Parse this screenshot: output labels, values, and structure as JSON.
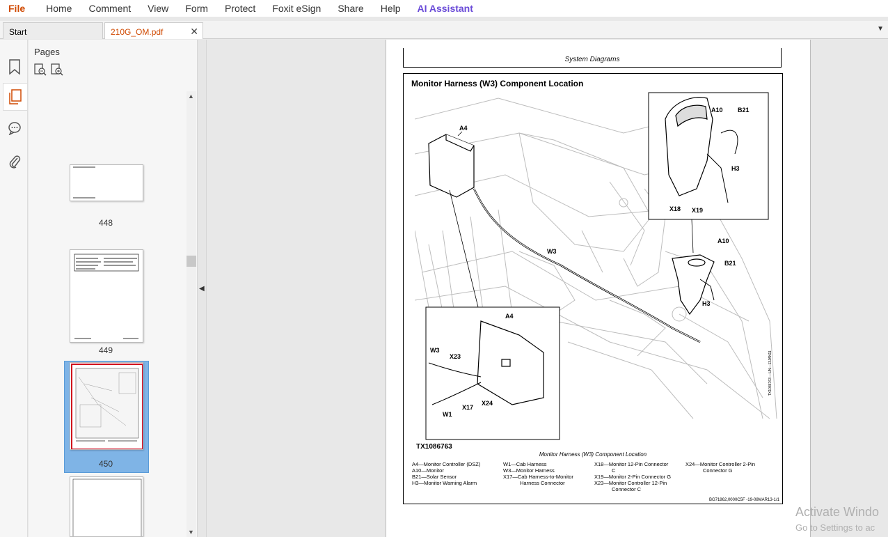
{
  "menu": {
    "file": "File",
    "home": "Home",
    "comment": "Comment",
    "view": "View",
    "form": "Form",
    "protect": "Protect",
    "esign": "Foxit eSign",
    "share": "Share",
    "help": "Help",
    "ai": "AI Assistant"
  },
  "tabs": {
    "start": "Start",
    "doc": "210G_OM.pdf"
  },
  "panel": {
    "title": "Pages",
    "thumbnails": [
      "448",
      "449",
      "450"
    ]
  },
  "document": {
    "header": "System Diagrams",
    "figure_title": "Monitor Harness (W3) Component Location",
    "figure_id": "TX1086763",
    "figure_side_text": "TX1086763 —UN—13JAN11",
    "caption": "Monitor Harness (W3) Component Location",
    "labels": {
      "a4": "A4",
      "a10": "A10",
      "b21": "B21",
      "h3": "H3",
      "x18": "X18",
      "x19": "X19",
      "w3": "W3",
      "x23": "X23",
      "x17": "X17",
      "x24": "X24",
      "w1": "W1"
    },
    "legend_col1": [
      "A4—Monitor Controller (DSZ)",
      "A10—Monitor",
      "B21—Solar Sensor",
      "H3—Monitor Warning Alarm"
    ],
    "legend_col2": [
      "W1—Cab Harness",
      "W3—Monitor Harness",
      "X17—Cab Harness-to-Monitor",
      "Harness Connector"
    ],
    "legend_col3": [
      "X18—Monitor 12-Pin Connector",
      "C",
      "X19—Monitor 2-Pin Connector G",
      "X23—Monitor Controller 12-Pin",
      "Connector C"
    ],
    "legend_col4": [
      "X24—Monitor Controller 2-Pin",
      "Connector G"
    ],
    "footer": "BG71862,0000C5F -19-08MAR13-1/1"
  },
  "watermark": {
    "line1": "Activate Windo",
    "line2": "Go to Settings to ac"
  }
}
